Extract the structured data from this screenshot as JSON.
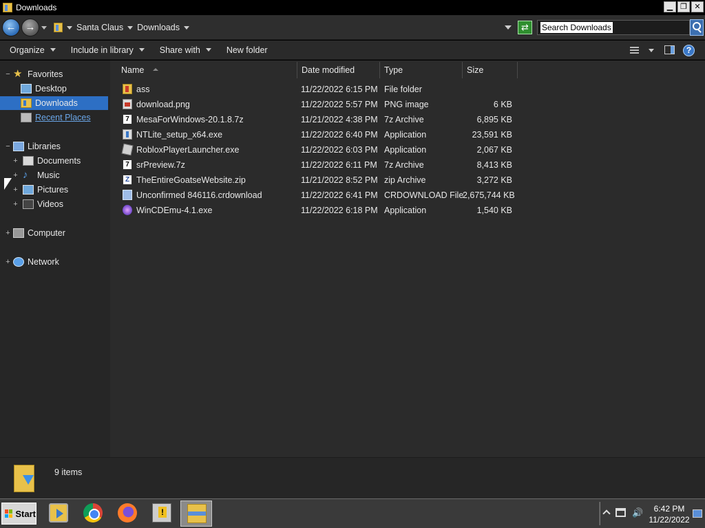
{
  "window": {
    "title": "Downloads"
  },
  "titlebar_buttons": {
    "minimize": "▁",
    "maximize": "❐",
    "close": "✕"
  },
  "address": {
    "crumbs": [
      "Santa Claus",
      "Downloads"
    ],
    "search_placeholder": "Search Downloads",
    "refresh_glyph": "⇄"
  },
  "toolbar": {
    "organize": "Organize",
    "include_in_library": "Include in library",
    "share_with": "Share with",
    "new_folder": "New folder",
    "help_glyph": "?"
  },
  "nav": {
    "favorites": {
      "label": "Favorites",
      "items": [
        {
          "label": "Desktop"
        },
        {
          "label": "Downloads",
          "selected": true
        },
        {
          "label": "Recent Places"
        }
      ]
    },
    "libraries": {
      "label": "Libraries",
      "items": [
        {
          "label": "Documents"
        },
        {
          "label": "Music"
        },
        {
          "label": "Pictures"
        },
        {
          "label": "Videos"
        }
      ]
    },
    "computer": {
      "label": "Computer"
    },
    "network": {
      "label": "Network"
    },
    "expanded_glyph": "−",
    "collapsed_glyph": "+",
    "star_glyph": "★",
    "music_glyph": "♪"
  },
  "columns": {
    "name": "Name",
    "date": "Date modified",
    "type": "Type",
    "size": "Size"
  },
  "files": [
    {
      "name": "ass",
      "date": "11/22/2022 6:15 PM",
      "type": "File folder",
      "size": "",
      "icon": "folder-icon"
    },
    {
      "name": "download.png",
      "date": "11/22/2022 5:57 PM",
      "type": "PNG image",
      "size": "6 KB",
      "icon": "png-image-icon"
    },
    {
      "name": "MesaForWindows-20.1.8.7z",
      "date": "11/21/2022 4:38 PM",
      "type": "7z Archive",
      "size": "6,895 KB",
      "icon": "7z-archive-icon"
    },
    {
      "name": "NTLite_setup_x64.exe",
      "date": "11/22/2022 6:40 PM",
      "type": "Application",
      "size": "23,591 KB",
      "icon": "installer-icon"
    },
    {
      "name": "RobloxPlayerLauncher.exe",
      "date": "11/22/2022 6:03 PM",
      "type": "Application",
      "size": "2,067 KB",
      "icon": "roblox-icon"
    },
    {
      "name": "srPreview.7z",
      "date": "11/22/2022 6:11 PM",
      "type": "7z Archive",
      "size": "8,413 KB",
      "icon": "7z-archive-icon"
    },
    {
      "name": "TheEntireGoatseWebsite.zip",
      "date": "11/21/2022 8:52 PM",
      "type": "zip Archive",
      "size": "3,272 KB",
      "icon": "zip-archive-icon"
    },
    {
      "name": "Unconfirmed 846116.crdownload",
      "date": "11/22/2022 6:41 PM",
      "type": "CRDOWNLOAD File",
      "size": "2,675,744 KB",
      "icon": "crdownload-icon"
    },
    {
      "name": "WinCDEmu-4.1.exe",
      "date": "11/22/2022 6:18 PM",
      "type": "Application",
      "size": "1,540 KB",
      "icon": "wincdemu-icon"
    }
  ],
  "details": {
    "count": "9 items"
  },
  "taskbar": {
    "start_label": "Start",
    "apps": [
      "media-player",
      "chrome",
      "firefox",
      "virtualbox-warning",
      "windows-explorer"
    ],
    "active_app": "windows-explorer",
    "speaker_glyph": "🔊",
    "clock_time": "6:42 PM",
    "clock_date": "11/22/2022"
  },
  "colors": {
    "selection": "#2d6fc4",
    "window_bg": "#2b2b2b",
    "link": "#6aa6e8"
  }
}
